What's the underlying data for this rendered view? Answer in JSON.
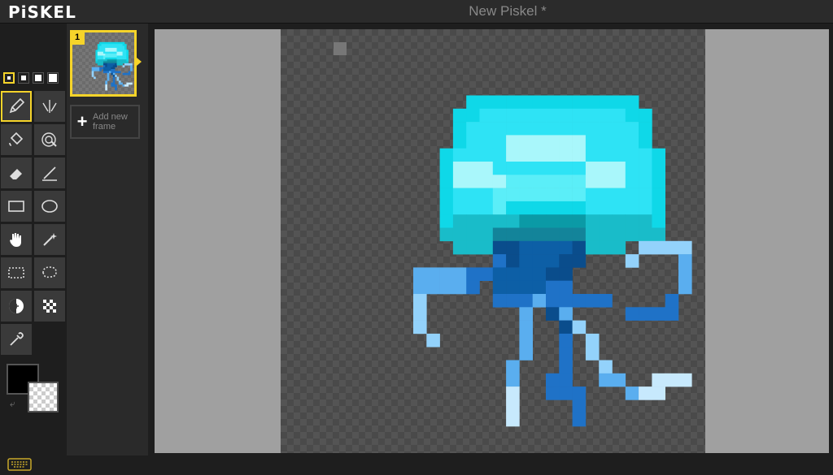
{
  "app": {
    "logo": "PiSKEL",
    "document_title": "New Piskel *"
  },
  "pen_sizes": {
    "count": 4,
    "selected": 1
  },
  "tools": [
    {
      "name": "pen-tool",
      "icon": "pencil-icon",
      "selected": true
    },
    {
      "name": "vertical-mirror-pen-tool",
      "icon": "mirror-pen-icon"
    },
    {
      "name": "paint-bucket-tool",
      "icon": "bucket-icon"
    },
    {
      "name": "paint-all-same-color-tool",
      "icon": "target-icon"
    },
    {
      "name": "eraser-tool",
      "icon": "eraser-icon"
    },
    {
      "name": "stroke-tool",
      "icon": "line-icon"
    },
    {
      "name": "rectangle-tool",
      "icon": "rectangle-icon"
    },
    {
      "name": "circle-tool",
      "icon": "ellipse-icon"
    },
    {
      "name": "move-tool",
      "icon": "hand-icon"
    },
    {
      "name": "shape-selection-tool",
      "icon": "magic-wand-icon"
    },
    {
      "name": "rectangle-selection-tool",
      "icon": "dashed-rectangle-icon"
    },
    {
      "name": "lasso-selection-tool",
      "icon": "lasso-icon"
    },
    {
      "name": "lighten-tool",
      "icon": "lighten-icon"
    },
    {
      "name": "dithering-tool",
      "icon": "checker-icon"
    },
    {
      "name": "color-picker-tool",
      "icon": "eyedropper-icon"
    }
  ],
  "colors": {
    "primary": "#000000",
    "secondary": "transparent",
    "accent": "#f6d42a"
  },
  "frames": {
    "items": [
      {
        "number": "1"
      }
    ],
    "add_label": "Add new\nframe"
  },
  "sprite": {
    "palette": {
      "a": "#0fd8e8",
      "b": "#2ee3f5",
      "c": "#5beef8",
      "d": "#a9f7fb",
      "e": "#d6fcfe",
      "f": "#19bcc9",
      "g": "#0b9aa6",
      "h": "#13849a",
      "D": "#0a4d8c",
      "M": "#0d5fa6",
      "B": "#1f72c7",
      "L": "#5aaeef",
      "S": "#93d2fb",
      "P": "#c7e9fd"
    },
    "rows": [
      "................................",
      "................................",
      "................................",
      "................................",
      "................................",
      "..............aaaaaaaaaaaaa.....",
      ".............aabbbbbbbbbbbaa....",
      ".............abbbbbbbbbbbbba....",
      ".............abbbddddddbbbba....",
      "............abbbbddddddbbbbba...",
      "............adddbbbbbbbdddbba...",
      "............addddccccccdddbba...",
      "............abbbcccccccbbbbba...",
      "............abbbcaaaaaabbbbba...",
      "............afffffgggggfffffa...",
      "............ffffhhhhhhhffffff...",
      ".............fffDDMMMMDfff.SSSS.",
      "................BDMMMDD...S...L.",
      "..........LLLLBBMMMMDD........L.",
      "..........LLLLB.MMMMBB........L.",
      "..........S.....BBBLBBBBB....B..",
      "..........S.......L.DL....BBBB..",
      "..........S.......L..DS.........",
      "...........S......L..B.S........",
      "..................L..B.S........",
      ".................L...B..S.......",
      ".................L..BB..LL..PPP.",
      ".................P..BBB...LPP...",
      ".................P....B.........",
      ".................P....B.........",
      "................................",
      "................................"
    ]
  }
}
